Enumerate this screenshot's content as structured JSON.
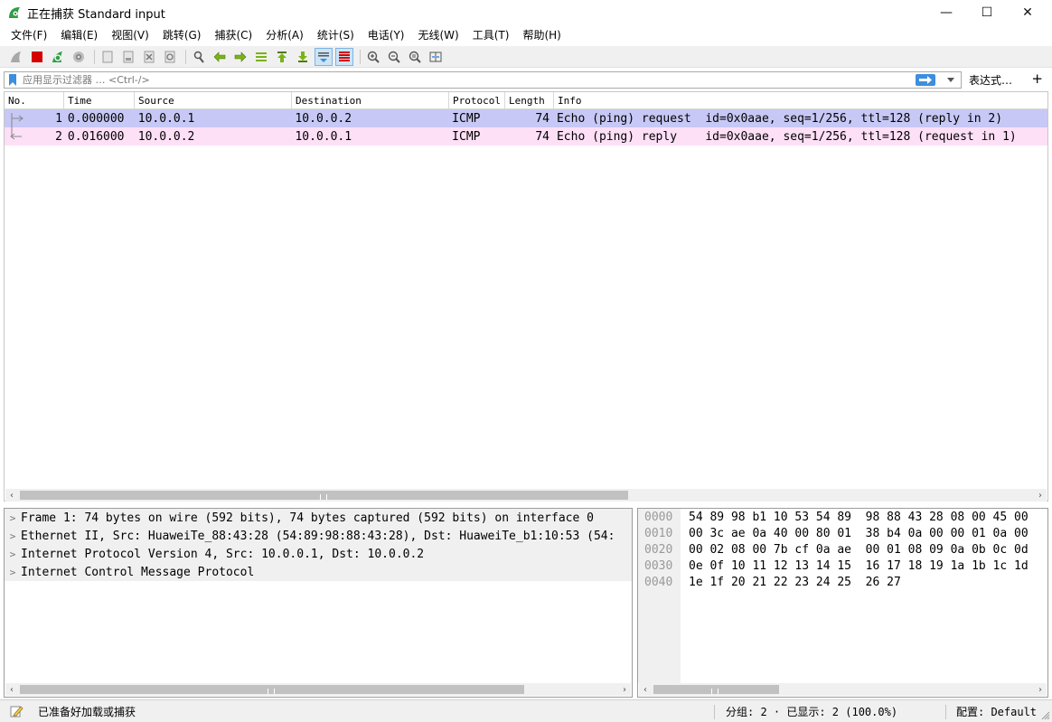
{
  "window": {
    "title": "正在捕获 Standard input",
    "minimize_glyph": "—",
    "maximize_glyph": "☐",
    "close_glyph": "✕"
  },
  "menu": [
    "文件(F)",
    "编辑(E)",
    "视图(V)",
    "跳转(G)",
    "捕获(C)",
    "分析(A)",
    "统计(S)",
    "电话(Y)",
    "无线(W)",
    "工具(T)",
    "帮助(H)"
  ],
  "toolbar_icons": [
    "shark-fin-start-icon",
    "stop-capture-icon",
    "restart-capture-icon",
    "capture-options-icon",
    "open-file-icon",
    "save-file-icon",
    "close-file-icon",
    "reload-file-icon",
    "find-packet-icon",
    "go-back-icon",
    "go-forward-icon",
    "go-to-packet-icon",
    "first-packet-icon",
    "last-packet-icon",
    "auto-scroll-icon",
    "colorize-icon",
    "zoom-in-icon",
    "zoom-out-icon",
    "normal-size-icon",
    "resize-columns-icon"
  ],
  "filter": {
    "placeholder": "应用显示过滤器 … <Ctrl-/>",
    "expression_label": "表达式…",
    "add_label": "+"
  },
  "packet_list": {
    "columns": [
      "No.",
      "Time",
      "Source",
      "Destination",
      "Protocol",
      "Length",
      "Info"
    ],
    "rows": [
      {
        "no": "1",
        "time": "0.000000",
        "source": "10.0.0.1",
        "destination": "10.0.0.2",
        "protocol": "ICMP",
        "length": "74",
        "info": "Echo (ping) request  id=0x0aae, seq=1/256, ttl=128 (reply in 2)"
      },
      {
        "no": "2",
        "time": "0.016000",
        "source": "10.0.0.2",
        "destination": "10.0.0.1",
        "protocol": "ICMP",
        "length": "74",
        "info": "Echo (ping) reply    id=0x0aae, seq=1/256, ttl=128 (request in 1)"
      }
    ]
  },
  "details": [
    "Frame 1: 74 bytes on wire (592 bits), 74 bytes captured (592 bits) on interface 0",
    "Ethernet II, Src: HuaweiTe_88:43:28 (54:89:98:88:43:28), Dst: HuaweiTe_b1:10:53 (54:",
    "Internet Protocol Version 4, Src: 10.0.0.1, Dst: 10.0.0.2",
    "Internet Control Message Protocol"
  ],
  "bytes": {
    "offsets": [
      "0000",
      "0010",
      "0020",
      "0030",
      "0040"
    ],
    "hex": [
      "54 89 98 b1 10 53 54 89  98 88 43 28 08 00 45 00",
      "00 3c ae 0a 40 00 80 01  38 b4 0a 00 00 01 0a 00",
      "00 02 08 00 7b cf 0a ae  00 01 08 09 0a 0b 0c 0d",
      "0e 0f 10 11 12 13 14 15  16 17 18 19 1a 1b 1c 1d",
      "1e 1f 20 21 22 23 24 25  26 27"
    ]
  },
  "status": {
    "ready": "已准备好加载或捕获",
    "packets": "分组: 2 · 已显示: 2 (100.0%)",
    "profile": "配置: Default"
  },
  "colors": {
    "selected_row": "#c7c8f5",
    "icmp_row": "#fde0f6",
    "accent_blue": "#3c8ede",
    "stop_red": "#d40000",
    "shark_green": "#2f9e44"
  }
}
